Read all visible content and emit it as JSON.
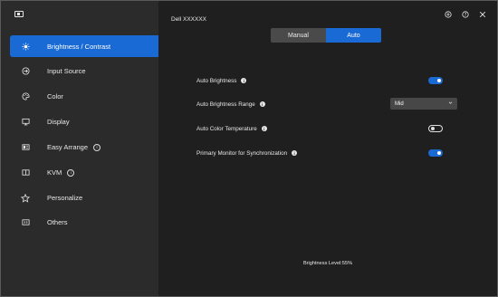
{
  "window": {
    "device_name": "Dell XXXXXX"
  },
  "sidebar": {
    "items": [
      {
        "label": "Brightness / Contrast",
        "icon": "sun-icon"
      },
      {
        "label": "Input Source",
        "icon": "input-source-icon"
      },
      {
        "label": "Color",
        "icon": "palette-icon"
      },
      {
        "label": "Display",
        "icon": "monitor-icon"
      },
      {
        "label": "Easy Arrange",
        "icon": "layout-icon"
      },
      {
        "label": "KVM",
        "icon": "kvm-icon"
      },
      {
        "label": "Personalize",
        "icon": "star-icon"
      },
      {
        "label": "Others",
        "icon": "others-icon"
      }
    ],
    "active_index": 0
  },
  "mode": {
    "manual_label": "Manual",
    "auto_label": "Auto",
    "selected": "Auto"
  },
  "settings": {
    "auto_brightness": {
      "label": "Auto Brightness",
      "enabled": true
    },
    "auto_brightness_range": {
      "label": "Auto Brightness Range",
      "value": "Mid"
    },
    "auto_color_temperature": {
      "label": "Auto Color Temperature",
      "enabled": false
    },
    "primary_monitor_sync": {
      "label": "Primary Monitor for Synchronization",
      "enabled": true
    }
  },
  "footer": {
    "brightness_level": "Brightness Level:55%"
  },
  "colors": {
    "accent": "#1a6ad6",
    "sidebar_bg": "#2b2b2b",
    "main_bg": "#1f1f1f"
  }
}
